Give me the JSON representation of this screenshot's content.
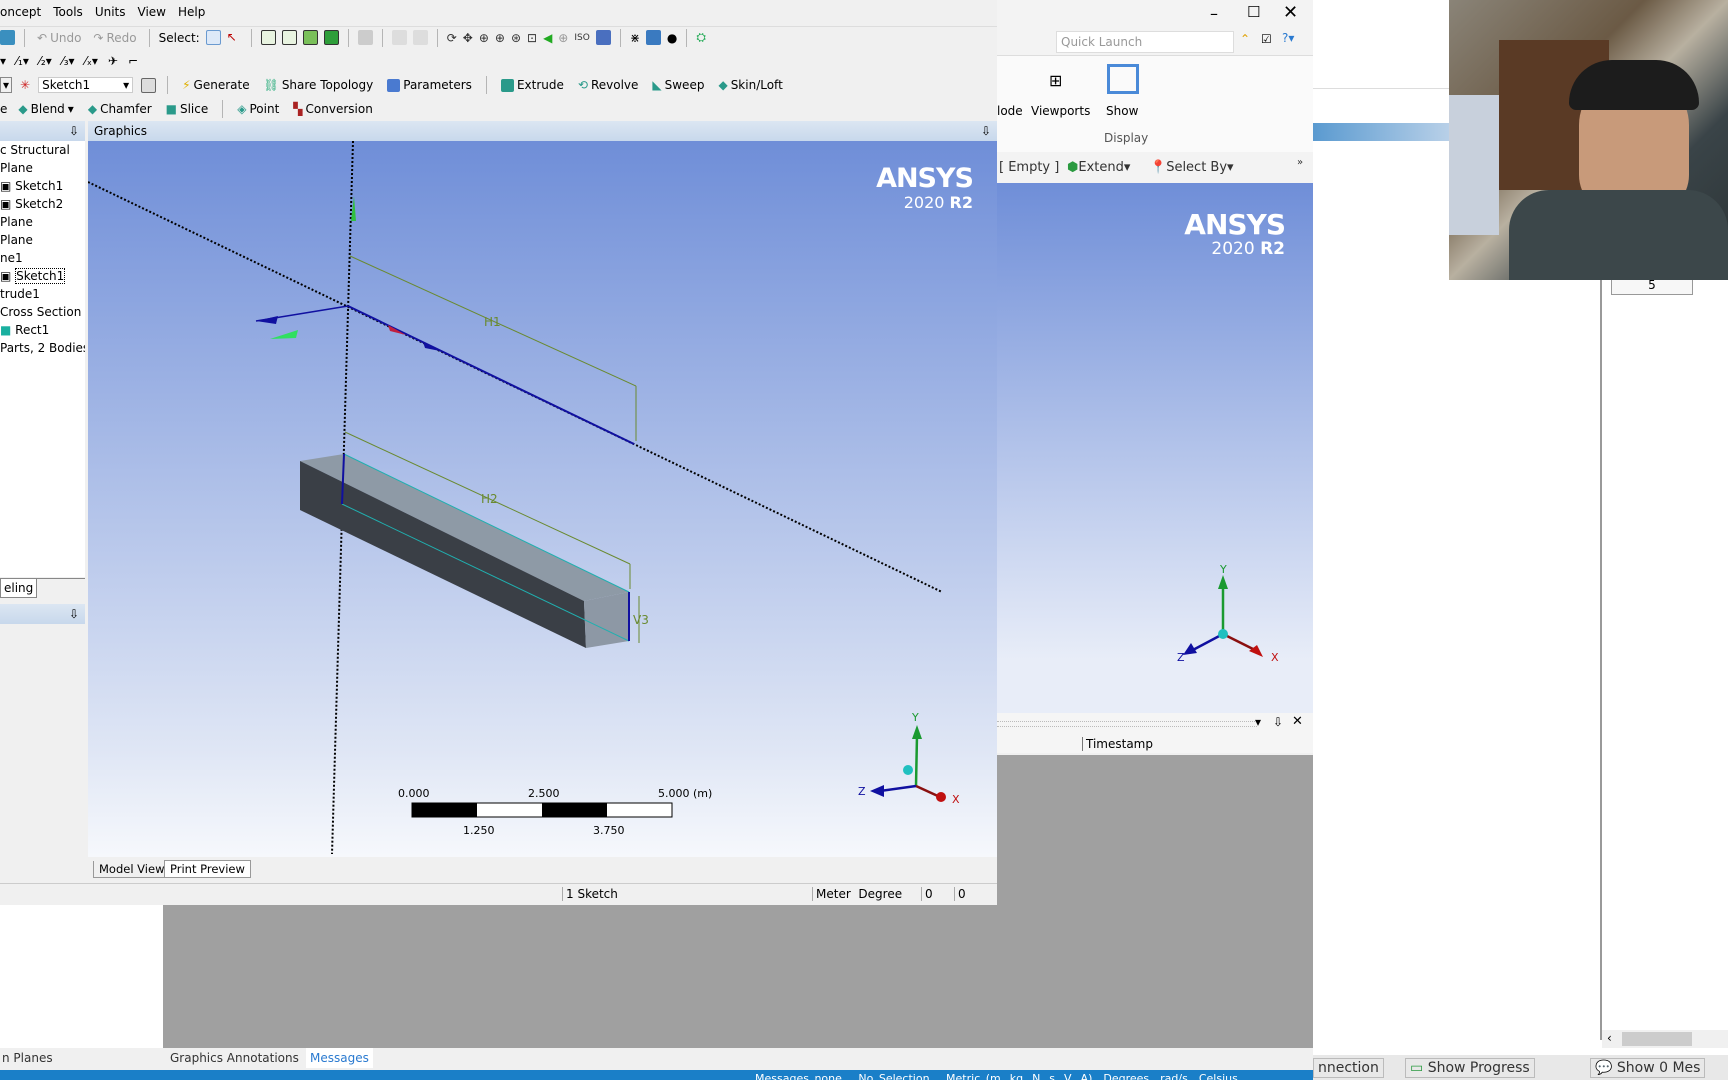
{
  "menu": [
    "oncept",
    "Tools",
    "Units",
    "View",
    "Help"
  ],
  "toolbar1": {
    "undo": "Undo",
    "redo": "Redo",
    "select": "Select:"
  },
  "toolbar3": {
    "sketch_select": "Sketch1",
    "generate": "Generate",
    "share_topology": "Share Topology",
    "parameters": "Parameters",
    "extrude": "Extrude",
    "revolve": "Revolve",
    "sweep": "Sweep",
    "skin_loft": "Skin/Loft"
  },
  "toolbar4": {
    "blend": "Blend",
    "chamfer": "Chamfer",
    "slice": "Slice",
    "point": "Point",
    "conversion": "Conversion"
  },
  "tree": {
    "items": [
      "c Structural",
      "Plane",
      "Sketch1",
      "Sketch2",
      "Plane",
      "Plane",
      "ne1",
      "Sketch1",
      "trude1",
      "Cross Section",
      "Rect1",
      "Parts, 2 Bodies"
    ],
    "tab": "eling"
  },
  "graphics": {
    "title": "Graphics",
    "logo": "ANSYS",
    "version": "2020",
    "release": "R2",
    "dims": {
      "h1": "H1",
      "h2": "H2",
      "v3": "V3"
    },
    "scale": {
      "labels_top": [
        "0.000",
        "2.500",
        "5.000 (m)"
      ],
      "labels_bottom": [
        "1.250",
        "3.750"
      ]
    },
    "triad": {
      "x": "X",
      "y": "Y",
      "z": "Z"
    },
    "colors": {
      "bg_top": "#6f8ed8",
      "bg_bottom": "#dfe6f5",
      "sketch": "#1010a0",
      "dim": "#6a8a30"
    }
  },
  "view_tabs": [
    "Model View",
    "Print Preview"
  ],
  "status": {
    "sketch": "1 Sketch",
    "unit_len": "Meter",
    "unit_ang": "Degree",
    "v1": "0",
    "v2": "0"
  },
  "bottom_tabs": {
    "left": "n Planes",
    "graphics_annotations": "Graphics Annotations",
    "messages": "Messages"
  },
  "bottom_status": [
    "Messages none",
    "No Selection",
    "Metric (m, kg, N, s, V, A)",
    "Degrees",
    "rad/s",
    "Celsius"
  ],
  "mech": {
    "quick_launch": "Quick Launch",
    "ribbon": {
      "mode": "lode",
      "viewports": "Viewports",
      "show": "Show",
      "display": "Display"
    },
    "toolbar": {
      "empty": "[ Empty ]",
      "extend": "Extend",
      "select_by": "Select By"
    },
    "logo": "ANSYS",
    "version": "2020",
    "release": "R2",
    "triad": {
      "x": "X",
      "y": "Y",
      "z": "Z"
    },
    "messages_col": "Timestamp"
  },
  "right": {
    "cell": "5",
    "connection": "nnection",
    "show_progress": "Show Progress",
    "show_messages": "Show 0 Mes"
  }
}
